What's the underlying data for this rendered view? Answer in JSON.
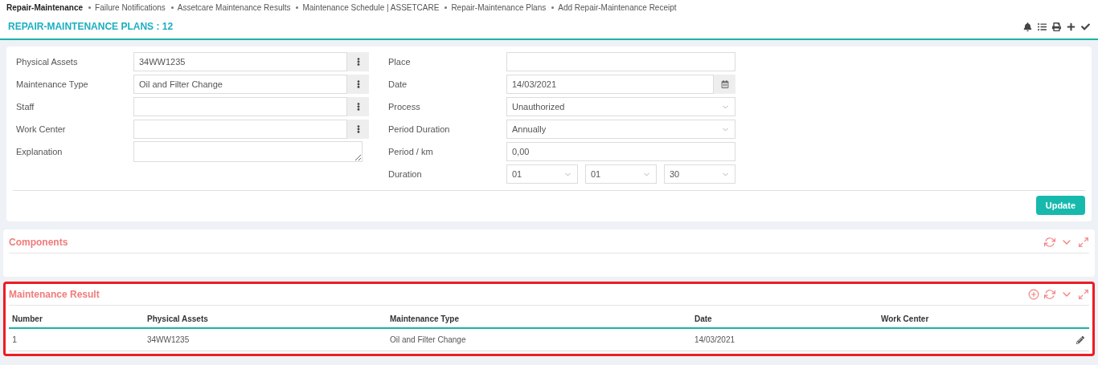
{
  "breadcrumbs": [
    {
      "label": "Repair-Maintenance",
      "selected": true
    },
    {
      "label": "Failure Notifications",
      "selected": false
    },
    {
      "label": "Assetcare Maintenance Results",
      "selected": false
    },
    {
      "label": "Maintenance Schedule | ASSETCARE",
      "selected": false
    },
    {
      "label": "Repair-Maintenance Plans",
      "selected": false
    },
    {
      "label": "Add Repair-Maintenance Receipt",
      "selected": false
    }
  ],
  "page_title": "REPAIR-MAINTENANCE PLANS : 12",
  "form": {
    "left_fields": [
      {
        "label": "Physical Assets",
        "kind": "picker",
        "value": "34WW1235"
      },
      {
        "label": "Maintenance Type",
        "kind": "picker",
        "value": "Oil and Filter Change"
      },
      {
        "label": "Staff",
        "kind": "picker"
      },
      {
        "label": "Work Center",
        "kind": "picker"
      },
      {
        "label": "Explanation",
        "kind": "textarea"
      }
    ],
    "right_fields": [
      {
        "label": "Place",
        "kind": "text"
      },
      {
        "label": "Date",
        "kind": "date",
        "value": "14/03/2021"
      },
      {
        "label": "Process",
        "kind": "select",
        "value": "Unauthorized"
      },
      {
        "label": "Period Duration",
        "kind": "select",
        "value": "Annually"
      },
      {
        "label": "Period / km",
        "kind": "text",
        "value": "0,00"
      },
      {
        "label": "Duration",
        "kind": "triple",
        "values": [
          "01",
          "01",
          "30"
        ]
      }
    ],
    "update_button": "Update"
  },
  "panels": [
    {
      "title": "Components",
      "highlighted": false,
      "can_add": false
    },
    {
      "title": "Maintenance Result",
      "highlighted": true,
      "can_add": true,
      "table": {
        "columns": [
          "Number",
          "Physical Assets",
          "Maintenance Type",
          "Date",
          "Work Center"
        ],
        "rows": [
          [
            "1",
            "34WW1235",
            "Oil and Filter Change",
            "14/03/2021",
            ""
          ]
        ]
      }
    }
  ]
}
